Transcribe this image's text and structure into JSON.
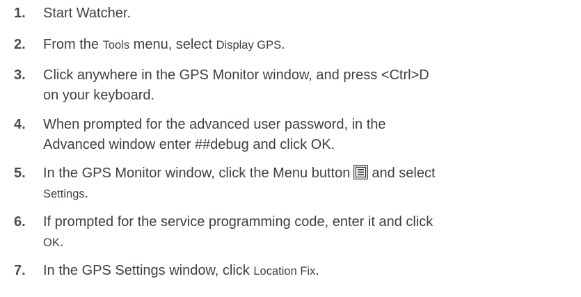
{
  "steps": [
    {
      "number": "1.",
      "text": "Start Watcher."
    },
    {
      "number": "2.",
      "pre": "From the ",
      "ui1": "Tools",
      "mid": " menu, select ",
      "ui2": "Display GPS",
      "post": "."
    },
    {
      "number": "3.",
      "line1": "Click anywhere in the GPS Monitor window, and press <Ctrl>D",
      "line2": "on your keyboard."
    },
    {
      "number": "4.",
      "line1": "When prompted for the advanced user password, in the",
      "line2": "Advanced window enter ##debug and click OK."
    },
    {
      "number": "5.",
      "pre": "In the GPS Monitor window, click the Menu button",
      "icon": "menu-button-icon",
      "post": "and select",
      "ui": "Settings",
      "end": "."
    },
    {
      "number": "6.",
      "line1": "If prompted for the service programming code, enter it and click",
      "ui": "OK",
      "end": "."
    },
    {
      "number": "7.",
      "pre": "In the GPS Settings window, click ",
      "ui": "Location Fix",
      "post": "."
    }
  ]
}
